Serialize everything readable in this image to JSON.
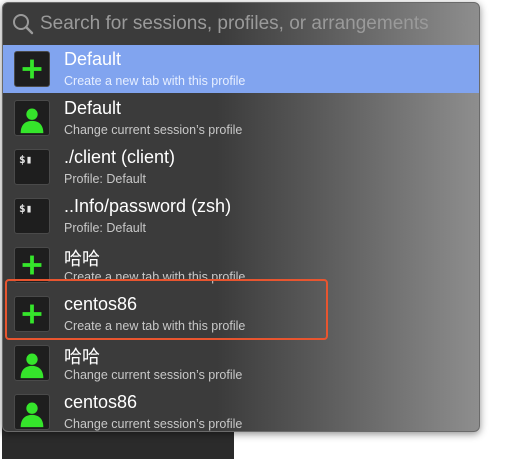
{
  "search": {
    "placeholder": "Search for sessions, profiles, or arrangements",
    "value": "",
    "clear_glyph": "×"
  },
  "colors": {
    "selection": "#81a4ef",
    "plus_icon": "#35e52b",
    "person_icon": "#35e52b",
    "annotation_box": "#e8552f"
  },
  "items": [
    {
      "icon": "plus-icon",
      "title": "Default",
      "subtitle": "Create a new tab with this profile",
      "selected": true
    },
    {
      "icon": "person-icon",
      "title": "Default",
      "subtitle": "Change current session’s profile",
      "selected": false
    },
    {
      "icon": "terminal-icon",
      "icon_text": "$▮",
      "title": "./client (client)",
      "subtitle": "Profile: Default",
      "selected": false
    },
    {
      "icon": "terminal-icon",
      "icon_text": "$▮",
      "title": "..Info/password (zsh)",
      "subtitle": "Profile: Default",
      "selected": false
    },
    {
      "icon": "plus-icon",
      "title": "哈哈",
      "subtitle": "Create a new tab with this profile",
      "selected": false
    },
    {
      "icon": "plus-icon",
      "title": "centos86",
      "subtitle": "Create a new tab with this profile",
      "selected": false
    },
    {
      "icon": "person-icon",
      "title": "哈哈",
      "subtitle": "Change current session’s profile",
      "selected": false
    },
    {
      "icon": "person-icon",
      "title": "centos86",
      "subtitle": "Change current session’s profile",
      "selected": false
    }
  ]
}
